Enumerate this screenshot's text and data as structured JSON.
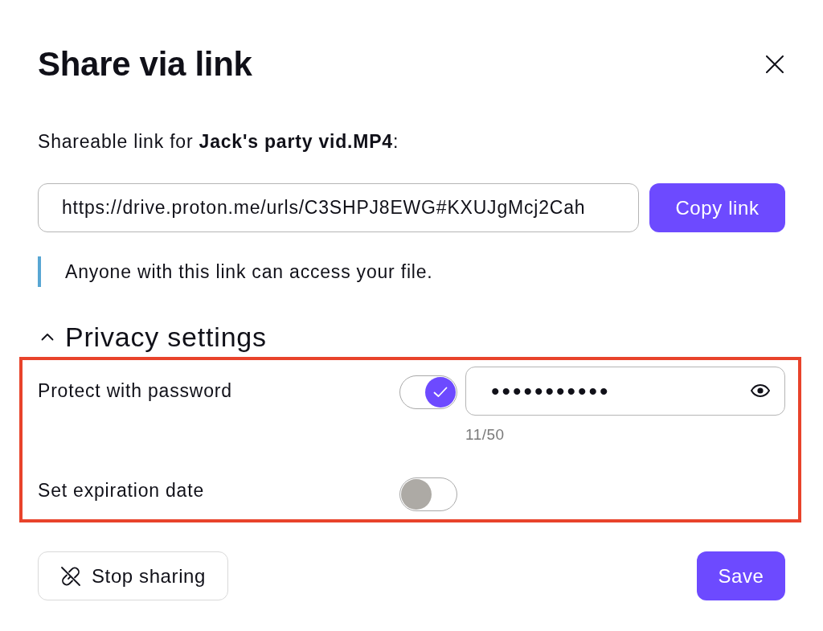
{
  "dialog": {
    "title": "Share via link",
    "intro": "Shareable link for **Jack's party vid.MP4**:",
    "link_field": {
      "value": "https://drive.proton.me/urls/C3SHPJ8EWG#KXUJgMcj2Cah"
    },
    "copy_button": "Copy link",
    "note": "Anyone with this link can access your file.",
    "privacy": {
      "title": "Privacy settings",
      "expanded": true,
      "highlighted": true,
      "settings": [
        {
          "kind": "password",
          "label": "Protect with password",
          "on": true,
          "value": "•••••••••••",
          "counter": "11/50"
        },
        {
          "kind": "expiration",
          "label": "Set expiration date",
          "on": false
        }
      ]
    },
    "footer": {
      "stop_button": "Stop sharing",
      "save_button": "Save"
    }
  }
}
